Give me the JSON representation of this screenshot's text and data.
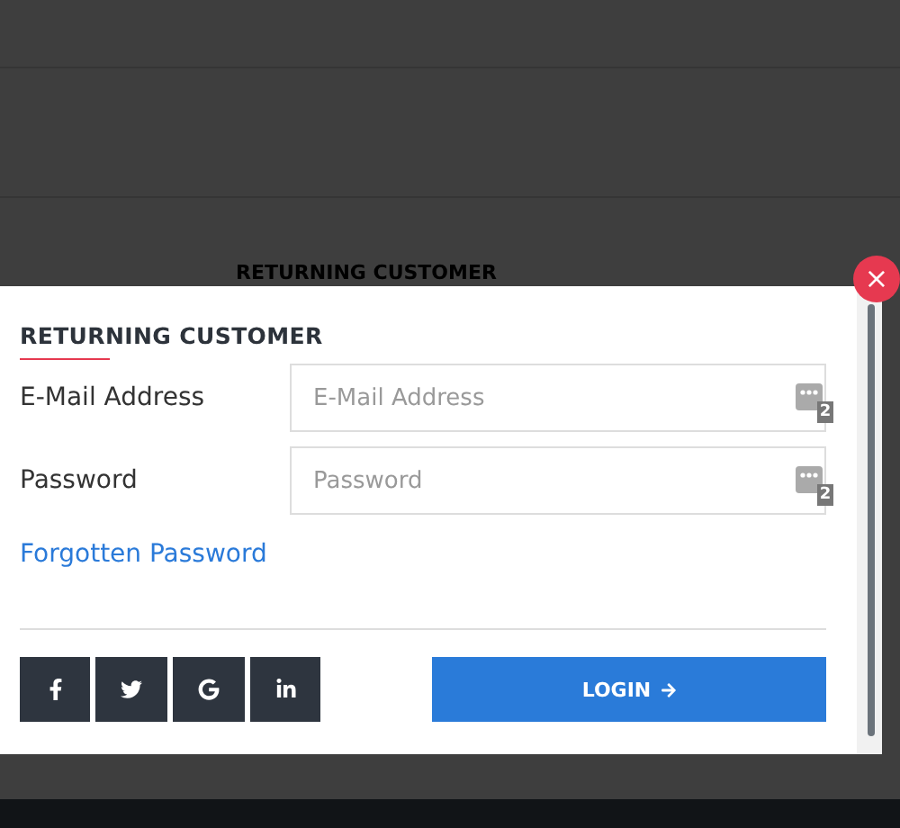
{
  "background": {
    "heading": "RETURNING CUSTOMER"
  },
  "modal": {
    "close_label": "×",
    "title": "RETURNING CUSTOMER",
    "fields": [
      {
        "label": "E-Mail Address",
        "placeholder": "E-Mail Address",
        "badge": "2"
      },
      {
        "label": "Password",
        "placeholder": "Password",
        "badge": "2"
      }
    ],
    "forgot_link": "Forgotten Password",
    "social_buttons": [
      {
        "kind": "facebook"
      },
      {
        "kind": "twitter"
      },
      {
        "kind": "google"
      },
      {
        "kind": "linkedin"
      }
    ],
    "login_button": "LOGIN"
  }
}
